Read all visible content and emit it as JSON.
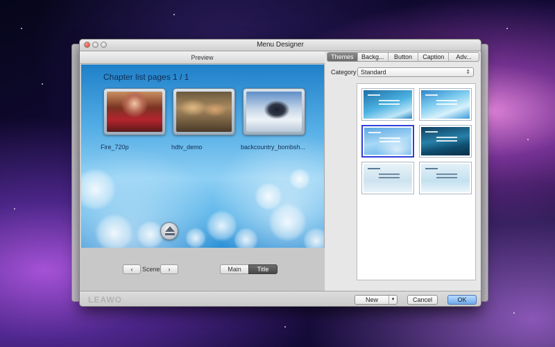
{
  "window": {
    "title": "Menu Designer"
  },
  "preview": {
    "header": "Preview",
    "chapter_title": "Chapter list pages 1 / 1",
    "chapters": [
      {
        "label": "Fire_720p"
      },
      {
        "label": "hdtv_demo"
      },
      {
        "label": "backcountry_bombsh..."
      }
    ]
  },
  "scene_nav": {
    "prev": "‹",
    "label": "Scene",
    "next": "›"
  },
  "view_tabs": {
    "main": "Main",
    "title": "Title",
    "selected": "Title"
  },
  "right_tabs": {
    "items": [
      "Themes",
      "Backg...",
      "Button",
      "Caption",
      "Adv..."
    ],
    "active": "Themes"
  },
  "category": {
    "label": "Category",
    "value": "Standard",
    "arrow": "⇕"
  },
  "themes": {
    "count": 6,
    "selected_index": 2
  },
  "footer": {
    "logo": "LEAWO",
    "new_button": "New",
    "new_arrow": "▾",
    "cancel_button": "Cancel",
    "ok_button": "OK"
  }
}
